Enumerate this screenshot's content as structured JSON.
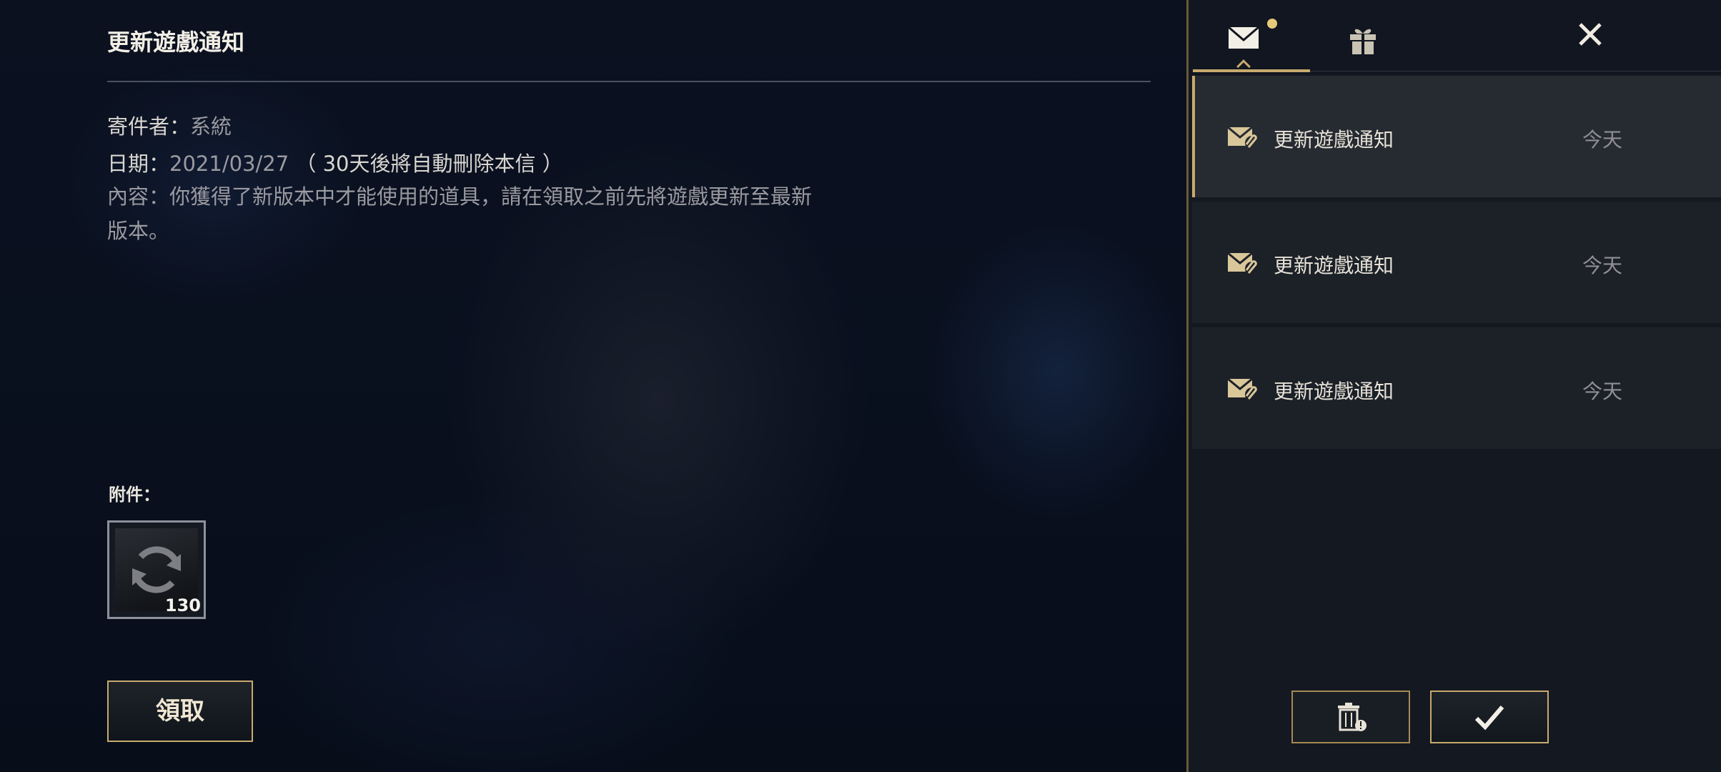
{
  "mail": {
    "title": "更新遊戲通知",
    "sender_label": "寄件者：",
    "sender_value": "系統",
    "date_label": "日期：",
    "date_value": "2021/03/27",
    "date_note": "（ 30天後將自動刪除本信 ）",
    "content_label": "內容：",
    "content_line1": "你獲得了新版本中才能使用的道具，請在領取之前先將遊戲更新至最新",
    "content_line2": "版本。",
    "attachments_label": "附件：",
    "attachment": {
      "icon": "refresh-icon",
      "count": "130"
    },
    "claim_label": "領取"
  },
  "panel": {
    "tabs": [
      {
        "icon": "mail-icon",
        "active": true,
        "has_notification": true
      },
      {
        "icon": "gift-icon",
        "active": false
      }
    ],
    "close_icon": "close-icon",
    "items": [
      {
        "icon": "mail-attachment-icon",
        "title": "更新遊戲通知",
        "date": "今天",
        "selected": true
      },
      {
        "icon": "mail-attachment-icon",
        "title": "更新遊戲通知",
        "date": "今天",
        "selected": false
      },
      {
        "icon": "mail-attachment-icon",
        "title": "更新遊戲通知",
        "date": "今天",
        "selected": false
      }
    ],
    "delete_icon": "delete-icon",
    "confirm_icon": "check-icon"
  },
  "colors": {
    "accent_gold": "#c8aa6e",
    "panel_bg": "#141820",
    "selected_item_bg": "#262a31"
  }
}
